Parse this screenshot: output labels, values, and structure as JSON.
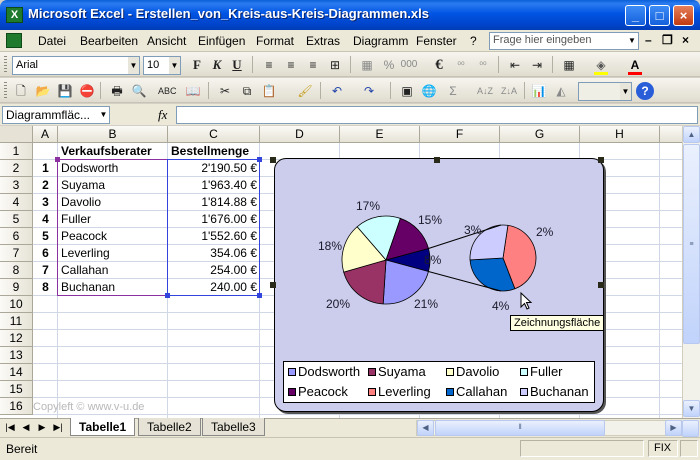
{
  "window": {
    "title": "Microsoft Excel - Erstellen_von_Kreis-aus-Kreis-Diagrammen.xls",
    "app_icon": "excel-icon",
    "controls": {
      "minimize": "_",
      "maximize": "□",
      "close": "×"
    }
  },
  "menu": {
    "items": [
      "Datei",
      "Bearbeiten",
      "Ansicht",
      "Einfügen",
      "Format",
      "Extras",
      "Diagramm",
      "Fenster",
      "?"
    ],
    "help_placeholder": "Frage hier eingeben",
    "doc_minimize": "–",
    "doc_restore": "❐",
    "doc_close": "×"
  },
  "format_toolbar": {
    "font": "Arial",
    "size": "10",
    "bold": "F",
    "italic": "K",
    "underline": "U",
    "percent": "%",
    "thousands": "000",
    "euro": "€"
  },
  "formula_bar": {
    "name_box": "Diagrammfläc...",
    "fx": "fx",
    "formula": ""
  },
  "sheet": {
    "columns": [
      "A",
      "B",
      "C",
      "D",
      "E",
      "F",
      "G",
      "H"
    ],
    "rows": [
      "1",
      "2",
      "3",
      "4",
      "5",
      "6",
      "7",
      "8",
      "9",
      "10",
      "11",
      "12",
      "13",
      "14",
      "15",
      "16"
    ],
    "header_b": "Verkaufsberater",
    "header_c": "Bestellmenge",
    "data": [
      {
        "idx": "1",
        "name": "Dodsworth",
        "value": "2'190.50 €"
      },
      {
        "idx": "2",
        "name": "Suyama",
        "value": "1'963.40 €"
      },
      {
        "idx": "3",
        "name": "Davolio",
        "value": "1'814.88 €"
      },
      {
        "idx": "4",
        "name": "Fuller",
        "value": "1'676.00 €"
      },
      {
        "idx": "5",
        "name": "Peacock",
        "value": "1'552.60 €"
      },
      {
        "idx": "6",
        "name": "Leverling",
        "value": "354.06 €"
      },
      {
        "idx": "7",
        "name": "Callahan",
        "value": "254.00 €"
      },
      {
        "idx": "8",
        "name": "Buchanan",
        "value": "240.00 €"
      }
    ]
  },
  "chart_data": {
    "type": "pie",
    "subtype": "pie-of-pie",
    "categories": [
      "Dodsworth",
      "Suyama",
      "Davolio",
      "Fuller",
      "Peacock",
      "Leverling",
      "Callahan",
      "Buchanan"
    ],
    "values": [
      2190.5,
      1963.4,
      1814.88,
      1676.0,
      1552.6,
      354.06,
      254.0,
      240.0
    ],
    "main_pie_labels": [
      "21%",
      "20%",
      "18%",
      "17%",
      "15%",
      "8%"
    ],
    "secondary_pie_labels": [
      "4%",
      "3%",
      "2%"
    ],
    "colors": {
      "Dodsworth": "#9999ff",
      "Suyama": "#993366",
      "Davolio": "#ffffcc",
      "Fuller": "#ccffff",
      "Peacock": "#660066",
      "Leverling": "#ff8080",
      "Callahan": "#0066cc",
      "Buchanan": "#ccccff",
      "other": "#000080"
    },
    "legend_position": "bottom",
    "plot_background": "#ccccec"
  },
  "tooltip": "Zeichnungsfläche",
  "watermark": "Copyleft © www.v-u.de",
  "tabs": [
    "Tabelle1",
    "Tabelle2",
    "Tabelle3"
  ],
  "tab_nav": [
    "|◀",
    "◀",
    "▶",
    "▶|"
  ],
  "status": {
    "left": "Bereit",
    "right": "FIX"
  }
}
